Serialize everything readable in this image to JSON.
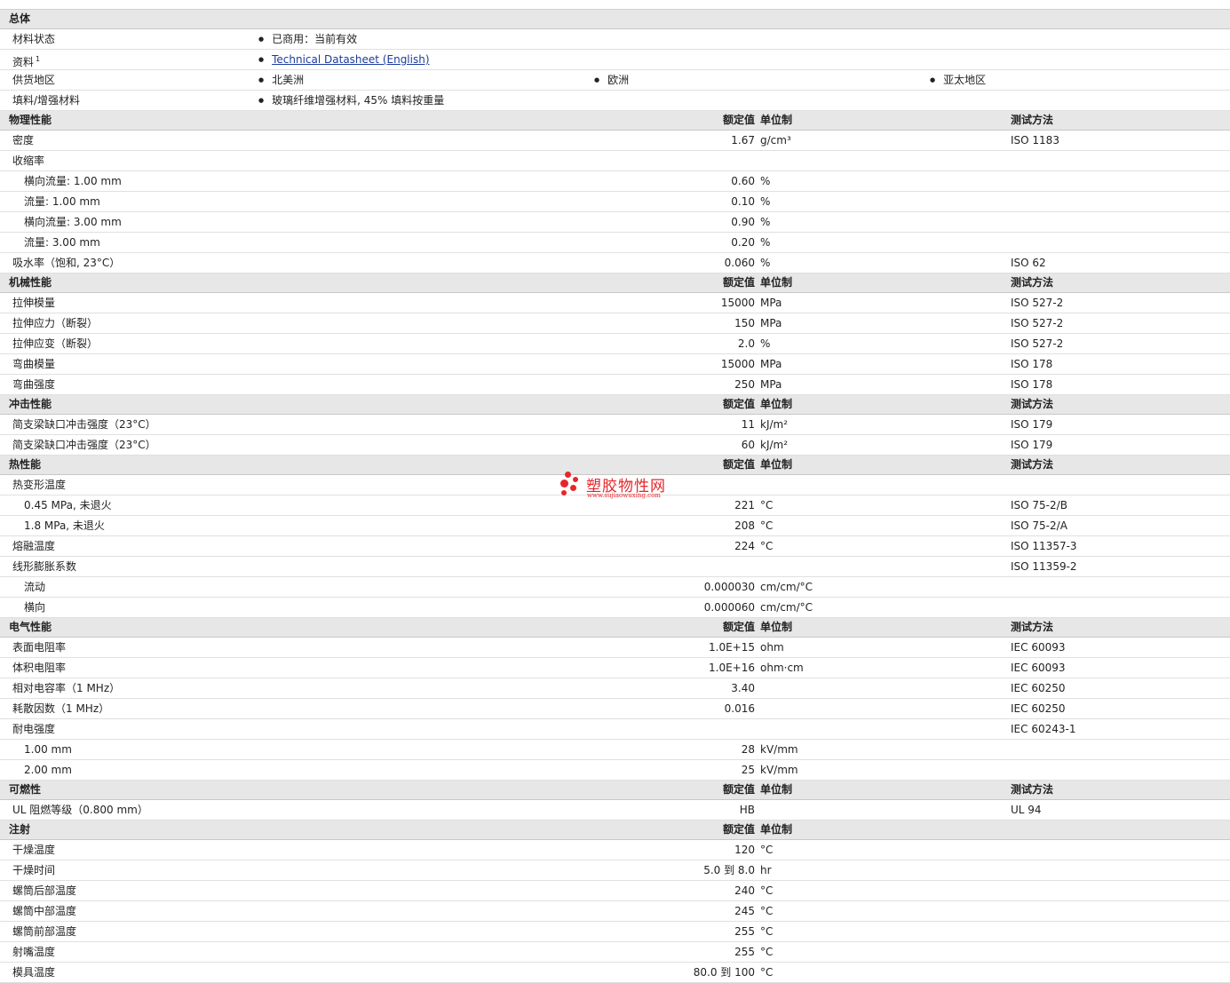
{
  "general": {
    "title": "总体",
    "rows": [
      {
        "label": "材料状态",
        "items": [
          "已商用：当前有效"
        ]
      },
      {
        "label": "资料",
        "sup": "1",
        "items": [
          "Technical Datasheet (English)"
        ],
        "link": true
      },
      {
        "label": "供货地区",
        "items": [
          "北美洲",
          "欧洲",
          "亚太地区"
        ]
      },
      {
        "label": "填料/增强材料",
        "items": [
          "玻璃纤维增强材料, 45% 填料按重量"
        ]
      }
    ]
  },
  "sections": [
    {
      "title": "物理性能",
      "h_val": "额定值",
      "h_unit": "单位制",
      "h_method": "测试方法",
      "rows": [
        {
          "label": "密度",
          "value": "1.67",
          "unit": "g/cm³",
          "method": "ISO 1183"
        },
        {
          "label": "收缩率",
          "value": "",
          "unit": "",
          "method": ""
        },
        {
          "label": "横向流量: 1.00 mm",
          "sub": true,
          "value": "0.60",
          "unit": "%",
          "method": ""
        },
        {
          "label": "流量: 1.00 mm",
          "sub": true,
          "value": "0.10",
          "unit": "%",
          "method": ""
        },
        {
          "label": "横向流量: 3.00 mm",
          "sub": true,
          "value": "0.90",
          "unit": "%",
          "method": ""
        },
        {
          "label": "流量: 3.00 mm",
          "sub": true,
          "value": "0.20",
          "unit": "%",
          "method": ""
        },
        {
          "label": "吸水率（饱和, 23°C）",
          "value": "0.060",
          "unit": "%",
          "method": "ISO 62"
        }
      ]
    },
    {
      "title": "机械性能",
      "h_val": "额定值",
      "h_unit": "单位制",
      "h_method": "测试方法",
      "rows": [
        {
          "label": "拉伸模量",
          "value": "15000",
          "unit": "MPa",
          "method": "ISO 527-2"
        },
        {
          "label": "拉伸应力（断裂）",
          "value": "150",
          "unit": "MPa",
          "method": "ISO 527-2"
        },
        {
          "label": "拉伸应变（断裂）",
          "value": "2.0",
          "unit": "%",
          "method": "ISO 527-2"
        },
        {
          "label": "弯曲模量",
          "value": "15000",
          "unit": "MPa",
          "method": "ISO 178"
        },
        {
          "label": "弯曲强度",
          "value": "250",
          "unit": "MPa",
          "method": "ISO 178"
        }
      ]
    },
    {
      "title": "冲击性能",
      "h_val": "额定值",
      "h_unit": "单位制",
      "h_method": "测试方法",
      "rows": [
        {
          "label": "简支梁缺口冲击强度（23°C）",
          "value": "11",
          "unit": "kJ/m²",
          "method": "ISO 179"
        },
        {
          "label": "简支梁缺口冲击强度（23°C）",
          "value": "60",
          "unit": "kJ/m²",
          "method": "ISO 179"
        }
      ]
    },
    {
      "title": "热性能",
      "h_val": "额定值",
      "h_unit": "单位制",
      "h_method": "测试方法",
      "rows": [
        {
          "label": "热变形温度",
          "value": "",
          "unit": "",
          "method": ""
        },
        {
          "label": "0.45 MPa, 未退火",
          "sub": true,
          "value": "221",
          "unit": "°C",
          "method": "ISO 75-2/B"
        },
        {
          "label": "1.8 MPa, 未退火",
          "sub": true,
          "value": "208",
          "unit": "°C",
          "method": "ISO 75-2/A"
        },
        {
          "label": "熔融温度",
          "value": "224",
          "unit": "°C",
          "method": "ISO 11357-3"
        },
        {
          "label": "线形膨胀系数",
          "value": "",
          "unit": "",
          "method": "ISO 11359-2"
        },
        {
          "label": "流动",
          "sub": true,
          "value": "0.000030",
          "unit": "cm/cm/°C",
          "method": ""
        },
        {
          "label": "横向",
          "sub": true,
          "value": "0.000060",
          "unit": "cm/cm/°C",
          "method": ""
        }
      ]
    },
    {
      "title": "电气性能",
      "h_val": "额定值",
      "h_unit": "单位制",
      "h_method": "测试方法",
      "rows": [
        {
          "label": "表面电阻率",
          "value": "1.0E+15",
          "unit": "ohm",
          "method": "IEC 60093"
        },
        {
          "label": "体积电阻率",
          "value": "1.0E+16",
          "unit": "ohm·cm",
          "method": "IEC 60093"
        },
        {
          "label": "相对电容率（1 MHz）",
          "value": "3.40",
          "unit": "",
          "method": "IEC 60250"
        },
        {
          "label": "耗散因数（1 MHz）",
          "value": "0.016",
          "unit": "",
          "method": "IEC 60250"
        },
        {
          "label": "耐电强度",
          "value": "",
          "unit": "",
          "method": "IEC 60243-1"
        },
        {
          "label": "1.00 mm",
          "sub": true,
          "value": "28",
          "unit": "kV/mm",
          "method": ""
        },
        {
          "label": "2.00 mm",
          "sub": true,
          "value": "25",
          "unit": "kV/mm",
          "method": ""
        }
      ]
    },
    {
      "title": "可燃性",
      "h_val": "额定值",
      "h_unit": "单位制",
      "h_method": "测试方法",
      "rows": [
        {
          "label": "UL 阻燃等级（0.800 mm）",
          "value": "HB",
          "unit": "",
          "method": "UL 94"
        }
      ]
    },
    {
      "title": "注射",
      "h_val": "额定值",
      "h_unit": "单位制",
      "h_method": "",
      "rows": [
        {
          "label": "干燥温度",
          "value": "120",
          "unit": "°C",
          "method": ""
        },
        {
          "label": "干燥时间",
          "value": "5.0 到 8.0",
          "unit": "hr",
          "method": ""
        },
        {
          "label": "螺筒后部温度",
          "value": "240",
          "unit": "°C",
          "method": ""
        },
        {
          "label": "螺筒中部温度",
          "value": "245",
          "unit": "°C",
          "method": ""
        },
        {
          "label": "螺筒前部温度",
          "value": "255",
          "unit": "°C",
          "method": ""
        },
        {
          "label": "射嘴温度",
          "value": "255",
          "unit": "°C",
          "method": ""
        },
        {
          "label": "模具温度",
          "value": "80.0 到 100",
          "unit": "°C",
          "method": ""
        }
      ]
    }
  ],
  "watermark": {
    "name": "塑胶物性网",
    "url": "www.sujiaowuxing.com",
    "color": "#e6262b"
  }
}
